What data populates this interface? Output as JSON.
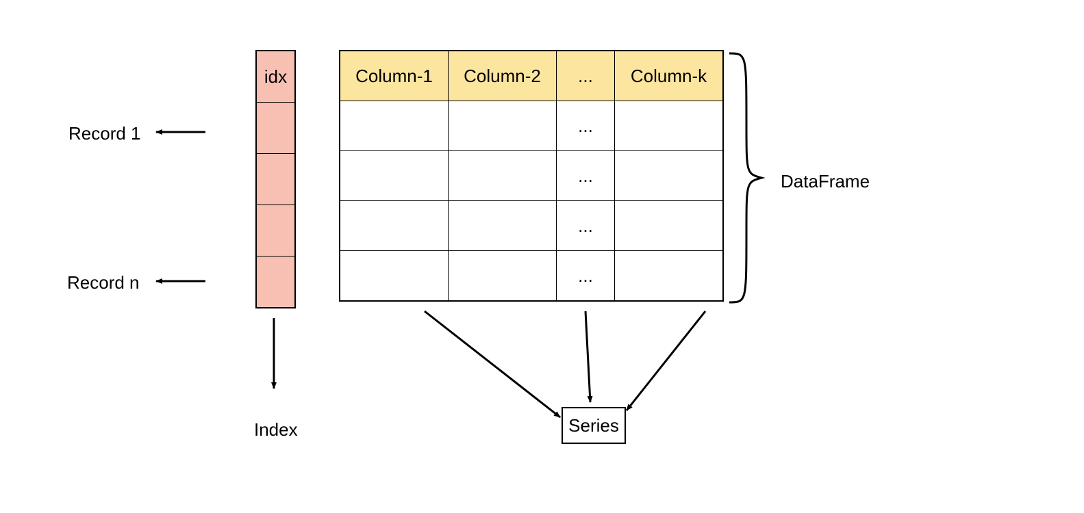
{
  "index": {
    "header": "idx",
    "label_below": "Index"
  },
  "records": {
    "first": "Record 1",
    "last": "Record n"
  },
  "columns": {
    "headers": [
      "Column-1",
      "Column-2",
      "...",
      "Column-k"
    ],
    "ellipsis_cell": "..."
  },
  "dataframe_label": "DataFrame",
  "series_label": "Series",
  "colors": {
    "index_fill": "#f8c0b3",
    "header_fill": "#fce59e",
    "cell_fill": "#ffffff",
    "border": "#000000"
  }
}
